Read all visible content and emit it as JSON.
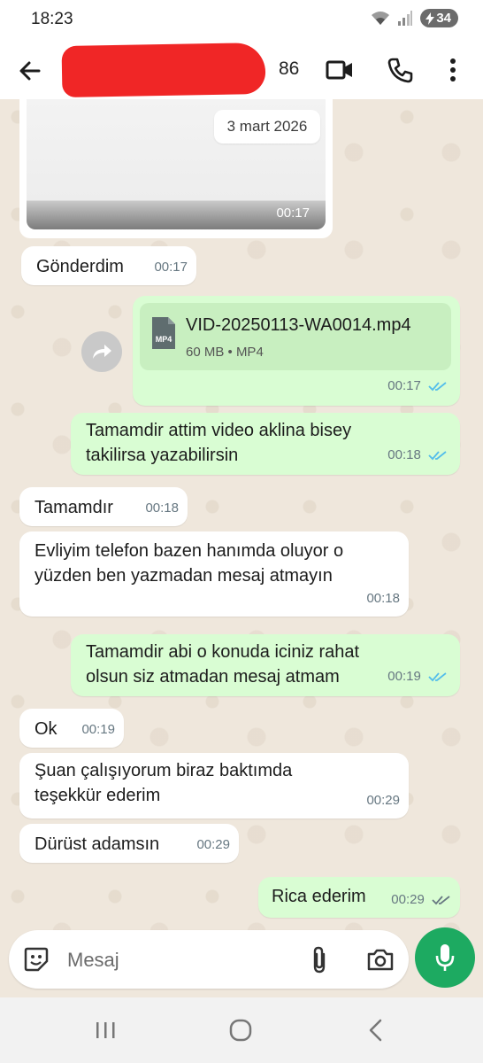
{
  "status_bar": {
    "time": "18:23",
    "battery": "34"
  },
  "header": {
    "contact_name_tail": "86"
  },
  "image_message": {
    "date_text": "3 mart 2026",
    "time": "00:17"
  },
  "messages": [
    {
      "dir": "in",
      "text": "Gönderdim",
      "time": "00:17"
    },
    {
      "dir": "out",
      "type": "file",
      "file_name": "VID-20250113-WA0014.mp4",
      "file_meta": "60 MB • MP4",
      "file_badge": "MP4",
      "time": "00:17",
      "status": "read"
    },
    {
      "dir": "out",
      "lines": [
        "Tamamdir attim video aklina bisey",
        "takilirsa yazabilirsin"
      ],
      "time": "00:18",
      "status": "read"
    },
    {
      "dir": "in",
      "text": "Tamamdır",
      "time": "00:18"
    },
    {
      "dir": "in",
      "lines": [
        "Evliyim telefon bazen hanımda oluyor o",
        "yüzden ben yazmadan mesaj atmayın"
      ],
      "time": "00:18"
    },
    {
      "dir": "out",
      "lines": [
        "Tamamdir abi o konuda iciniz rahat",
        "olsun siz atmadan mesaj atmam"
      ],
      "time": "00:19",
      "status": "read"
    },
    {
      "dir": "in",
      "text": "Ok",
      "time": "00:19"
    },
    {
      "dir": "in",
      "lines": [
        "Şuan çalışıyorum biraz baktımda",
        "teşekkür ederim"
      ],
      "time": "00:29"
    },
    {
      "dir": "in",
      "text": "Dürüst adamsın",
      "time": "00:29"
    },
    {
      "dir": "out",
      "text": "Rica ederim",
      "time": "00:29",
      "status": "delivered"
    }
  ],
  "composer": {
    "placeholder": "Mesaj"
  },
  "colors": {
    "accent": "#1daa61",
    "outgoing_bubble": "#d9fdd3",
    "incoming_bubble": "#ffffff",
    "read_tick": "#53bdeb",
    "chat_background": "#efe7dc"
  },
  "icons": {
    "header": [
      "back-arrow-icon",
      "video-call-icon",
      "phone-icon",
      "more-vert-icon"
    ],
    "composer": [
      "sticker-icon",
      "attach-icon",
      "camera-icon",
      "mic-icon"
    ],
    "nav": [
      "recents-icon",
      "home-icon",
      "back-icon"
    ]
  }
}
